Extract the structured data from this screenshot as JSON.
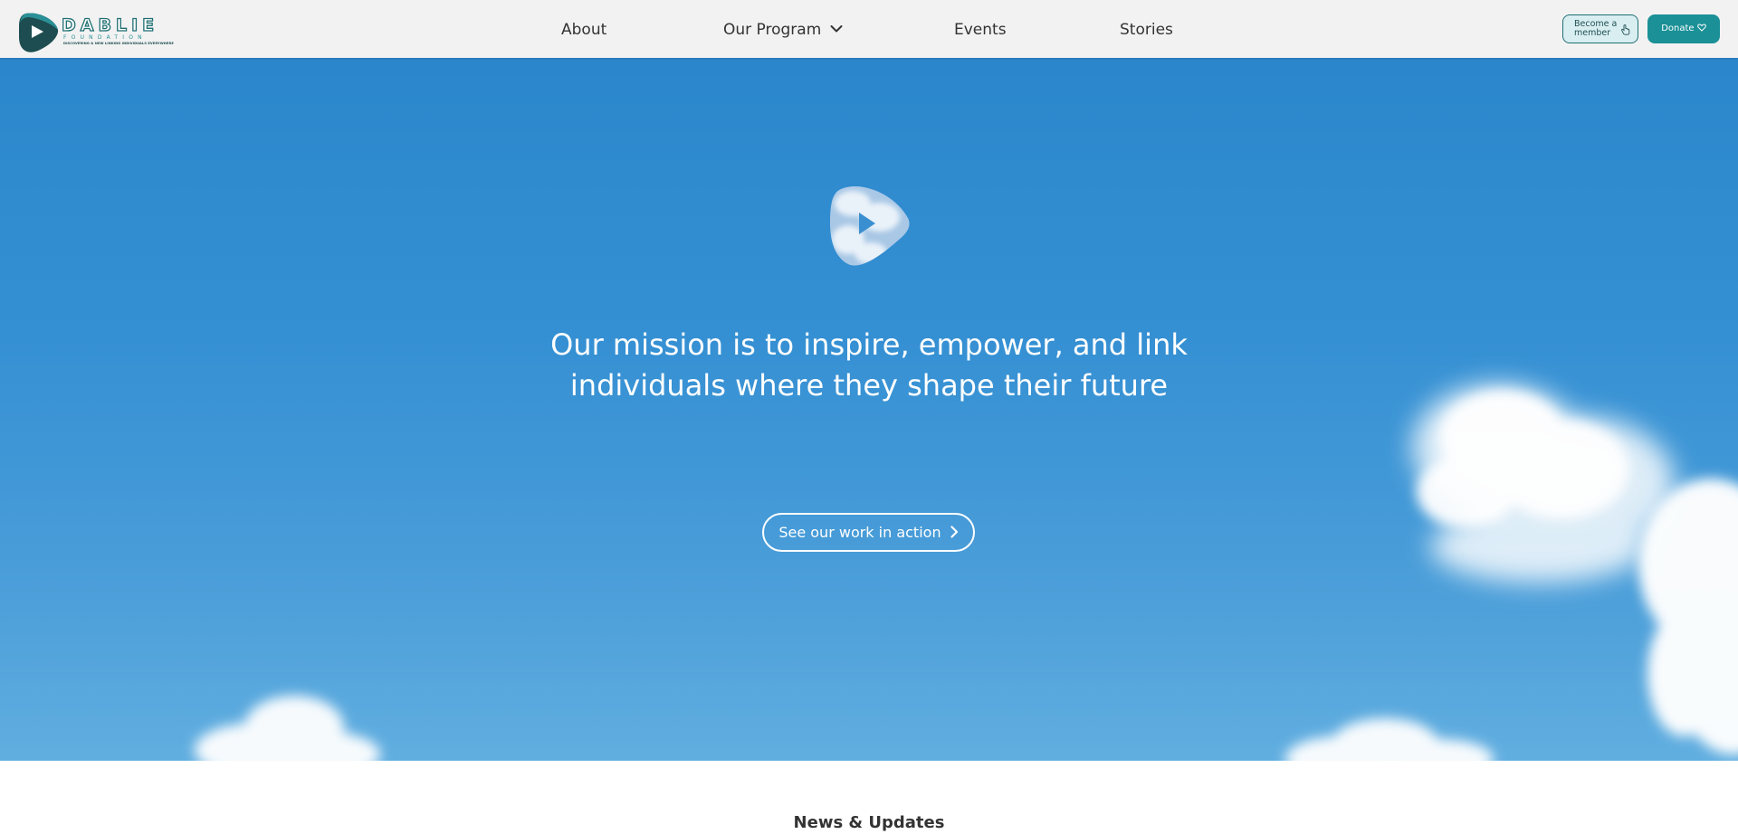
{
  "brand": {
    "name": "DABLIE",
    "subtitle": "FOUNDATION",
    "tagline": "DISCOVERING & NEW LINKING INDIVIDUALS EVERYWHERE",
    "colors": {
      "primary": "#1f6f73",
      "accent": "#1b9097",
      "hero_blue": "#2b86cb"
    }
  },
  "nav": {
    "items": [
      {
        "label": "About"
      },
      {
        "label": "Our Program",
        "icon": "chevron-down-icon"
      },
      {
        "label": "Events"
      },
      {
        "label": "Stories"
      }
    ]
  },
  "actions": {
    "member_label": "Become a member",
    "member_icon": "hand-pointer-icon",
    "donate_label": "Donate",
    "donate_icon": "heart-icon"
  },
  "hero": {
    "emblem_icon": "cloud-play-icon",
    "mission": "Our mission is to inspire, empower, and link individuals where they shape their future",
    "cta_label": "See our work in action",
    "cta_icon": "chevron-right-icon"
  },
  "news": {
    "title": "News & Updates"
  }
}
